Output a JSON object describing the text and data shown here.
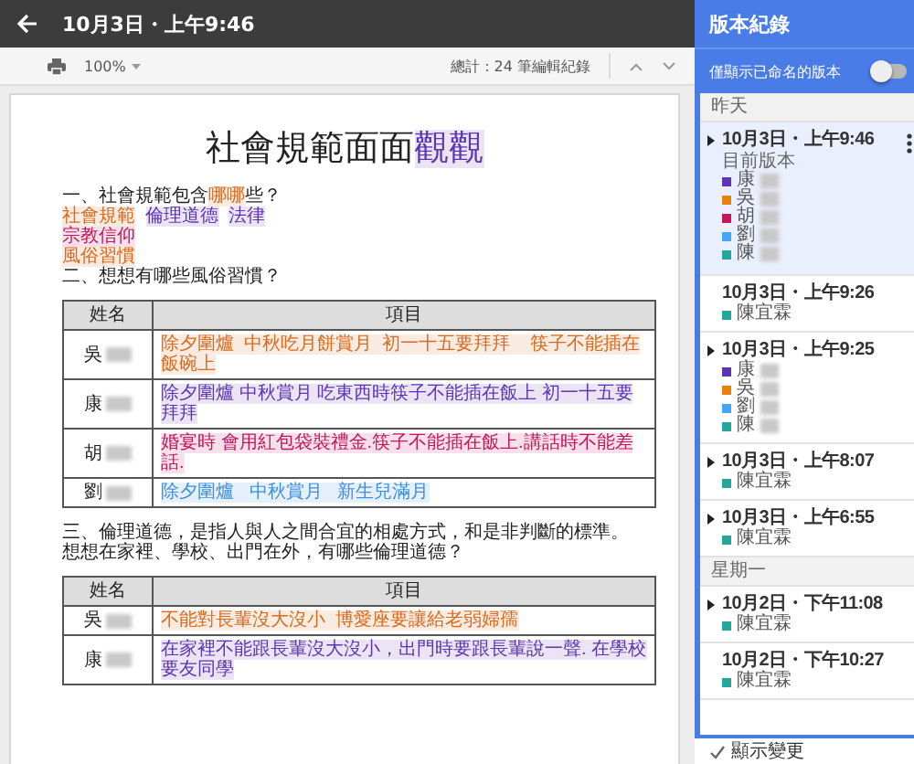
{
  "top_bar": {
    "title": "10月3日・上午9:46"
  },
  "toolbar": {
    "zoom": "100%",
    "edit_count": "總計：24 筆編輯紀錄"
  },
  "document": {
    "title": [
      {
        "text": "社會規範面面"
      },
      {
        "text": "觀觀",
        "color": "#5e35b1"
      }
    ],
    "blocks": [
      {
        "kind": "line",
        "segments": [
          {
            "text": "一、社會規範包含"
          },
          {
            "text": "哪哪",
            "color": "#d86a1e"
          },
          {
            "text": "些？"
          }
        ]
      },
      {
        "kind": "line",
        "segments": [
          {
            "text": "社會規範",
            "color": "#d86a1e"
          },
          {
            "text": "倫理道德",
            "color": "#5e35b1"
          },
          {
            "text": "法律",
            "color": "#5e35b1"
          }
        ]
      },
      {
        "kind": "line",
        "segments": [
          {
            "text": "宗教信仰",
            "color": "#c2185b"
          }
        ]
      },
      {
        "kind": "line",
        "segments": [
          {
            "text": "風俗習慣",
            "color": "#d86a1e"
          }
        ]
      },
      {
        "kind": "line",
        "segments": [
          {
            "text": "二、想想有哪些風俗習慣？"
          }
        ]
      },
      {
        "kind": "table",
        "columns": [
          "姓名",
          "項目"
        ],
        "rows": [
          {
            "name": "吳",
            "redacted": true,
            "segments": [
              {
                "text": "除夕圍爐  中秋吃月餅賞月  初一十五要拜拜    筷子不能插在飯碗上",
                "color": "#d86a1e"
              }
            ]
          },
          {
            "name": "康",
            "redacted": true,
            "segments": [
              {
                "text": "除夕圍爐 中秋賞月 吃東西時筷子不能插在飯上 初一十五要拜拜",
                "color": "#5e35b1"
              }
            ]
          },
          {
            "name": "胡",
            "redacted": true,
            "segments": [
              {
                "text": "婚宴時 會用紅包袋裝禮金.筷子不能插在飯上.講話時不能差話.",
                "color": "#c2185b"
              }
            ]
          },
          {
            "name": "劉",
            "redacted": true,
            "segments": [
              {
                "text": "除夕圍爐   中秋賞月   新生兒滿月",
                "color": "#3d8fe0"
              }
            ]
          }
        ]
      },
      {
        "kind": "line",
        "segments": [
          {
            "text": "三、倫理道德，是指人與人之間合宜的相處方式，和是非判斷的標準。"
          }
        ]
      },
      {
        "kind": "line",
        "segments": [
          {
            "text": "想想在家裡、學校、出門在外，有哪些倫理道德？"
          }
        ]
      },
      {
        "kind": "table",
        "columns": [
          "姓名",
          "項目"
        ],
        "rows": [
          {
            "name": "吳",
            "redacted": true,
            "segments": [
              {
                "text": "不能對長輩沒大沒小  博愛座要讓給老弱婦孺",
                "color": "#d86a1e"
              }
            ]
          },
          {
            "name": "康",
            "redacted": true,
            "segments": [
              {
                "text": "在家裡不能跟長輩沒大沒小，出門時要跟長輩說一聲. 在學校要友同學",
                "color": "#5e35b1"
              }
            ]
          }
        ]
      }
    ]
  },
  "history_panel": {
    "title": "版本紀錄",
    "named_only": {
      "label": "僅顯示已命名的版本",
      "on": false
    },
    "groups": [
      {
        "label": "昨天",
        "versions": [
          {
            "time": "10月3日・上午9:46",
            "expandable": true,
            "selected": true,
            "note": "目前版本",
            "authors": [
              {
                "name": "康",
                "redacted": true,
                "color": "#5e35b1"
              },
              {
                "name": "吳",
                "redacted": true,
                "color": "#e8820c"
              },
              {
                "name": "胡",
                "redacted": true,
                "color": "#c2185b"
              },
              {
                "name": "劉",
                "redacted": true,
                "color": "#42a5f5"
              },
              {
                "name": "陳",
                "redacted": true,
                "color": "#26a69a"
              }
            ]
          },
          {
            "time": "10月3日・上午9:26",
            "expandable": false,
            "selected": false,
            "authors": [
              {
                "name": "陳宜霖",
                "redacted": false,
                "color": "#26a69a"
              }
            ]
          },
          {
            "time": "10月3日・上午9:25",
            "expandable": true,
            "selected": false,
            "authors": [
              {
                "name": "康",
                "redacted": true,
                "color": "#5e35b1"
              },
              {
                "name": "吳",
                "redacted": true,
                "color": "#e8820c"
              },
              {
                "name": "劉",
                "redacted": true,
                "color": "#42a5f5"
              },
              {
                "name": "陳",
                "redacted": true,
                "color": "#26a69a"
              }
            ]
          },
          {
            "time": "10月3日・上午8:07",
            "expandable": true,
            "selected": false,
            "authors": [
              {
                "name": "陳宜霖",
                "redacted": false,
                "color": "#26a69a"
              }
            ]
          },
          {
            "time": "10月3日・上午6:55",
            "expandable": true,
            "selected": false,
            "authors": [
              {
                "name": "陳宜霖",
                "redacted": false,
                "color": "#26a69a"
              }
            ]
          }
        ]
      },
      {
        "label": "星期一",
        "versions": [
          {
            "time": "10月2日・下午11:08",
            "expandable": true,
            "selected": false,
            "authors": [
              {
                "name": "陳宜霖",
                "redacted": false,
                "color": "#26a69a"
              }
            ]
          },
          {
            "time": "10月2日・下午10:27",
            "expandable": false,
            "selected": false,
            "authors": [
              {
                "name": "陳宜霖",
                "redacted": false,
                "color": "#26a69a"
              }
            ]
          }
        ]
      }
    ],
    "show_changes": {
      "label": "顯示變更",
      "checked": true
    }
  }
}
